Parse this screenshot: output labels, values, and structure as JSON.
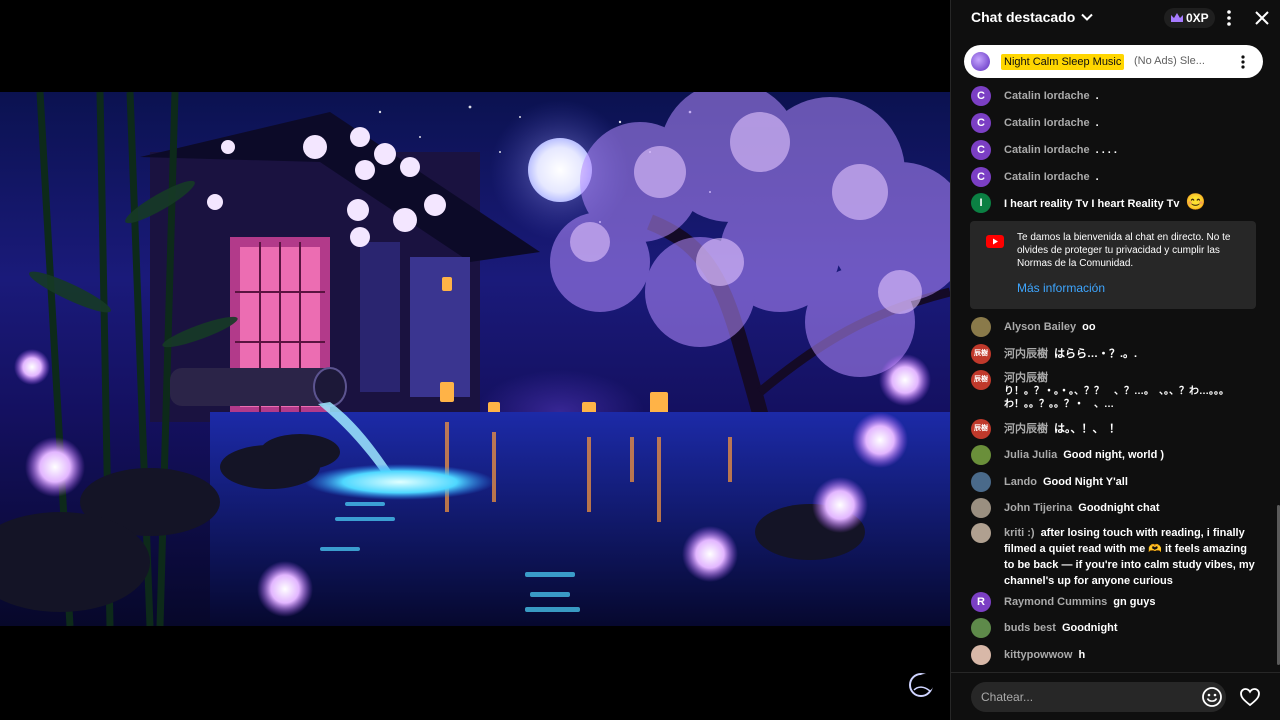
{
  "chat": {
    "title": "Chat destacado",
    "xp": "0XP",
    "pinned": {
      "name": "Night Calm Sleep Music",
      "text": "(No Ads) Sle..."
    },
    "messages": [
      {
        "author": "Catalin Iordache",
        "text": ".",
        "initial": "C",
        "color": "#7b3fc4"
      },
      {
        "author": "Catalin Iordache",
        "text": ".",
        "initial": "C",
        "color": "#7b3fc4"
      },
      {
        "author": "Catalin Iordache",
        "text": ". . . .",
        "initial": "C",
        "color": "#7b3fc4"
      },
      {
        "author": "Catalin Iordache",
        "text": ".",
        "initial": "C",
        "color": "#7b3fc4"
      },
      {
        "author": "I heart reality Tv I heart Reality Tv",
        "text": "😊",
        "initial": "I",
        "color": "#0b8043"
      }
    ],
    "notice": {
      "text": "Te damos la bienvenida al chat en directo. No te olvides de proteger tu privacidad y cumplir las Normas de la Comunidad.",
      "link": "Más información"
    },
    "messages2": [
      {
        "author": "Alyson Bailey",
        "text": "oo",
        "initial": "",
        "color": "#8a7a4a"
      },
      {
        "author": "河内辰樹",
        "text": "はらら…・？.。.",
        "initial": "辰樹",
        "color": "#c0392b"
      },
      {
        "author": "河内辰樹",
        "text": "り！。？・。・。、？？　、？…。　、。、？わ…。。。わ！。。？。。？・　、…",
        "initial": "辰樹",
        "color": "#c0392b"
      },
      {
        "author": "河内辰樹",
        "text": "は。、！、　！",
        "initial": "辰樹",
        "color": "#c0392b"
      },
      {
        "author": "Julia Julia",
        "text": "Good night, world )",
        "initial": "",
        "color": "#6a8f3a"
      },
      {
        "author": "Lando",
        "text": "Good Night Y'all",
        "initial": "",
        "color": "#4a6a8a"
      },
      {
        "author": "John Tijerina",
        "text": "Goodnight chat",
        "initial": "",
        "color": "#9a8f80"
      },
      {
        "author": "kriti :)",
        "text": "after losing touch with reading, i finally filmed a quiet read with me 🫶 it feels amazing to be back — if you're into calm study vibes, my channel's up for anyone curious",
        "initial": "",
        "color": "#b0a090"
      },
      {
        "author": "Raymond Cummins",
        "text": "gn guys",
        "initial": "R",
        "color": "#7b3fc4"
      },
      {
        "author": "buds best",
        "text": "Goodnight",
        "initial": "",
        "color": "#5e8a4a"
      },
      {
        "author": "kittypowwow",
        "text": "h",
        "initial": "",
        "color": "#d8b8a8"
      }
    ],
    "input_placeholder": "Chatear..."
  },
  "icons": {
    "chevron": "chevron-down-icon",
    "crown": "crown-icon",
    "more": "more-vert-icon",
    "close": "close-icon",
    "youtube": "youtube-icon",
    "emoji": "emoji-icon",
    "heart": "heart-icon"
  }
}
